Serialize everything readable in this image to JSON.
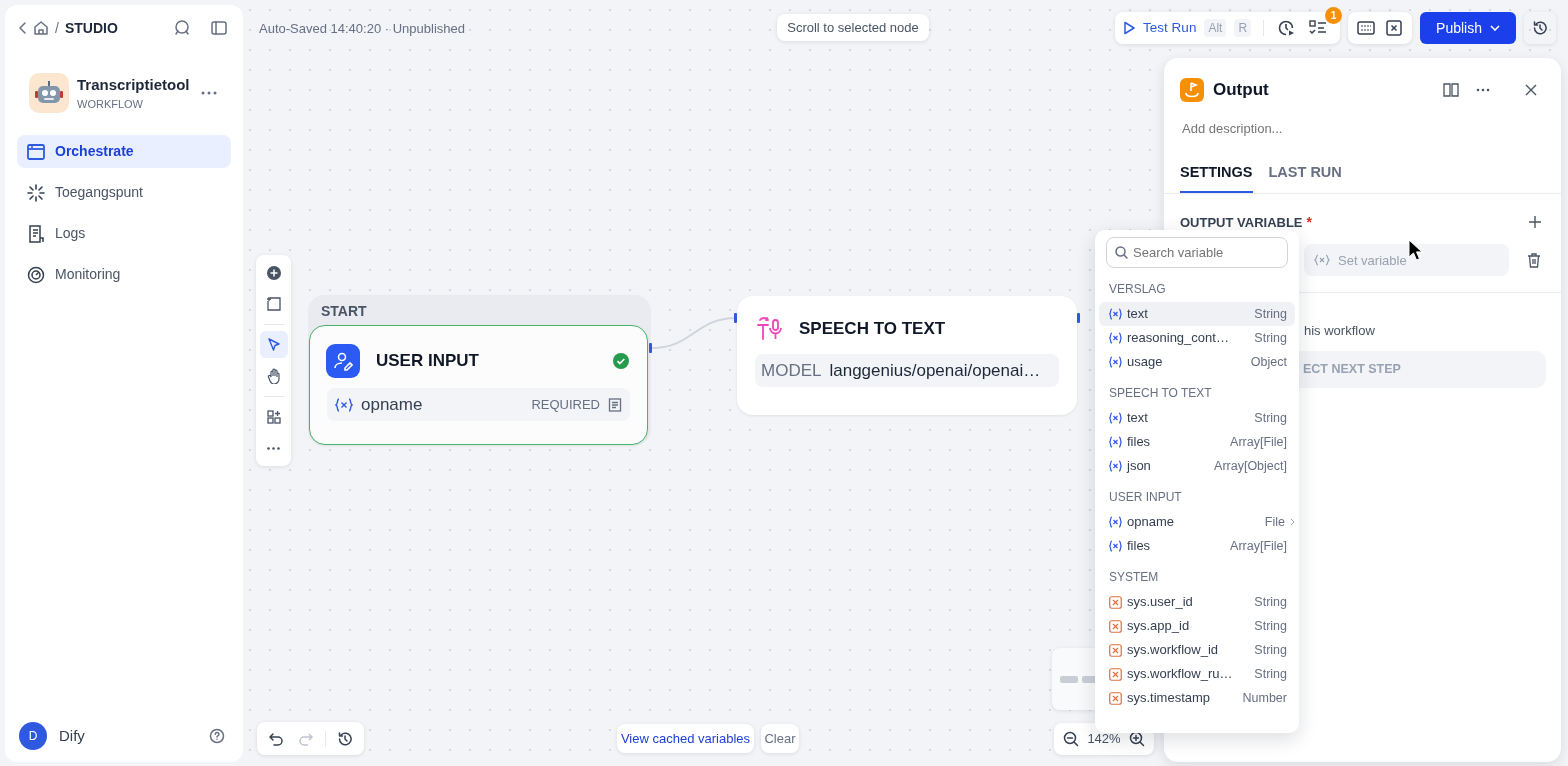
{
  "sidebar": {
    "breadcrumb_separator": "/",
    "breadcrumb": "STUDIO",
    "app": {
      "name": "Transcriptietool",
      "type": "WORKFLOW"
    },
    "nav": [
      {
        "label": "Orchestrate",
        "selected": true
      },
      {
        "label": "Toegangspunt",
        "selected": false
      },
      {
        "label": "Logs",
        "selected": false
      },
      {
        "label": "Monitoring",
        "selected": false
      }
    ],
    "user": {
      "initial": "D",
      "name": "Dify"
    }
  },
  "topbar": {
    "autosave": "Auto-Saved 14:40:20 · Unpublished",
    "scroll_hint": "Scroll to selected node",
    "test_run": {
      "label": "Test Run",
      "keys": [
        "Alt",
        "R"
      ]
    },
    "checklist_badge": "1",
    "publish": "Publish"
  },
  "canvas": {
    "start_group": "START",
    "user_input_node": {
      "title": "USER INPUT",
      "valid": true,
      "variable": "opname",
      "tag": "REQUIRED"
    },
    "speech_node": {
      "title": "SPEECH TO TEXT",
      "model_label": "MODEL",
      "model": "langgenius/openai/openai…"
    },
    "zoom": "142%",
    "cached_link": "View cached variables",
    "clear": "Clear"
  },
  "panel": {
    "title": "Output",
    "description_placeholder": "Add description...",
    "tabs": [
      {
        "label": "SETTINGS",
        "selected": true
      },
      {
        "label": "LAST RUN",
        "selected": false
      }
    ],
    "section": "OUTPUT VARIABLE",
    "required_mark": "*",
    "field_placeholder": "Set variable",
    "hint": "his workflow",
    "next_step": "ECT NEXT STEP"
  },
  "variable_picker": {
    "search_placeholder": "Search variable",
    "groups": [
      {
        "title": "VERSLAG",
        "items": [
          {
            "name": "text",
            "type": "String",
            "kind": "node",
            "selected": true,
            "expandable": false
          },
          {
            "name": "reasoning_cont…",
            "type": "String",
            "kind": "node",
            "selected": false,
            "expandable": false
          },
          {
            "name": "usage",
            "type": "Object",
            "kind": "node",
            "selected": false,
            "expandable": false
          }
        ]
      },
      {
        "title": "SPEECH TO TEXT",
        "items": [
          {
            "name": "text",
            "type": "String",
            "kind": "node",
            "selected": false,
            "expandable": false
          },
          {
            "name": "files",
            "type": "Array[File]",
            "kind": "node",
            "selected": false,
            "expandable": false
          },
          {
            "name": "json",
            "type": "Array[Object]",
            "kind": "node",
            "selected": false,
            "expandable": false
          }
        ]
      },
      {
        "title": "USER INPUT",
        "items": [
          {
            "name": "opname",
            "type": "File",
            "kind": "node",
            "selected": false,
            "expandable": true
          },
          {
            "name": "files",
            "type": "Array[File]",
            "kind": "node",
            "selected": false,
            "expandable": false
          }
        ]
      },
      {
        "title": "SYSTEM",
        "items": [
          {
            "name": "sys.user_id",
            "type": "String",
            "kind": "system",
            "selected": false,
            "expandable": false
          },
          {
            "name": "sys.app_id",
            "type": "String",
            "kind": "system",
            "selected": false,
            "expandable": false
          },
          {
            "name": "sys.workflow_id",
            "type": "String",
            "kind": "system",
            "selected": false,
            "expandable": false
          },
          {
            "name": "sys.workflow_ru…",
            "type": "String",
            "kind": "system",
            "selected": false,
            "expandable": false
          },
          {
            "name": "sys.timestamp",
            "type": "Number",
            "kind": "system",
            "selected": false,
            "expandable": false
          }
        ]
      }
    ]
  }
}
